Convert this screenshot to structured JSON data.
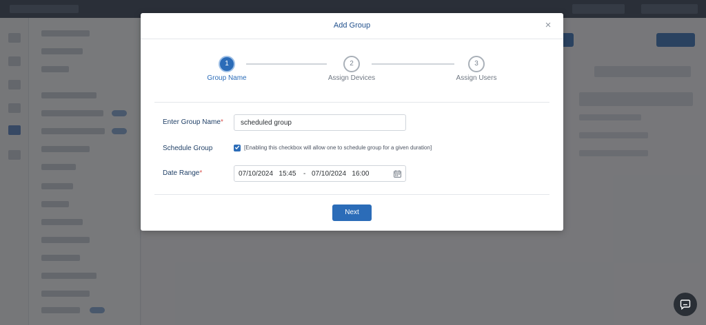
{
  "modal": {
    "title": "Add Group",
    "close_glyph": "×",
    "steps": [
      {
        "number": "1",
        "label": "Group Name",
        "active": true
      },
      {
        "number": "2",
        "label": "Assign Devices",
        "active": false
      },
      {
        "number": "3",
        "label": "Assign Users",
        "active": false
      }
    ],
    "form": {
      "group_name_label": "Enter Group Name",
      "group_name_value": "scheduled group",
      "schedule_label": "Schedule Group",
      "schedule_checked": true,
      "schedule_hint": "[Enabling this checkbox will allow one to schedule group for a given duration]",
      "date_range_label": "Date Range",
      "date_start": "07/10/2024   15:45",
      "date_separator": "-",
      "date_end": "07/10/2024   16:00",
      "required_marker": "*"
    },
    "next_label": "Next"
  },
  "icons": {
    "close": "close-icon",
    "calendar": "calendar-icon",
    "chat": "chat-icon",
    "checkmark": "checkmark-icon"
  },
  "colors": {
    "primary": "#2b6cb8",
    "title": "#1f4f8c",
    "required": "#d9534f"
  }
}
